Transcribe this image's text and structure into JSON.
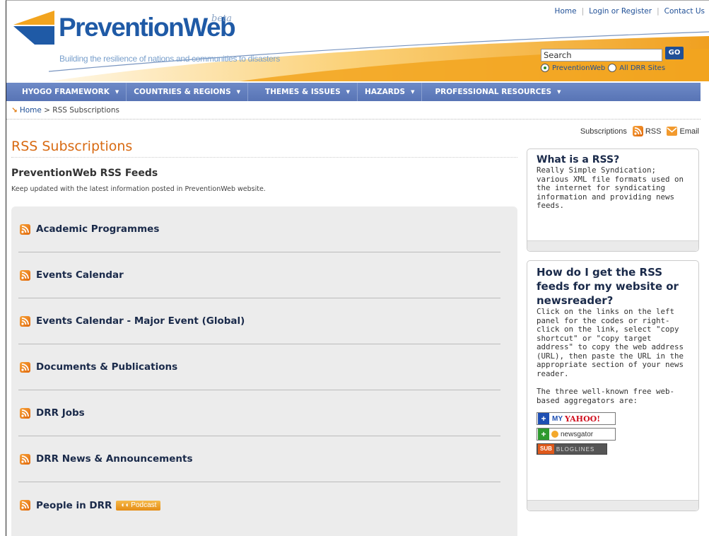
{
  "header": {
    "logo_text": "PreventionWeb",
    "logo_beta": "beta",
    "tagline": "Building the resilience of nations and communities to disasters",
    "top_links": [
      "Home",
      "Login or Register",
      "Contact Us"
    ],
    "search_value": "Search",
    "go_label": "GO",
    "scope_options": [
      "PreventionWeb",
      "All DRR Sites"
    ],
    "scope_selected": "PreventionWeb"
  },
  "nav": {
    "items": [
      "HYOGO FRAMEWORK",
      "COUNTRIES & REGIONS",
      "THEMES & ISSUES",
      "HAZARDS",
      "PROFESSIONAL RESOURCES"
    ]
  },
  "breadcrumb": {
    "home": "Home",
    "current": "> RSS Subscriptions"
  },
  "subscriptions": {
    "label": "Subscriptions",
    "rss": "RSS",
    "email": "Email"
  },
  "main": {
    "page_title": "RSS Subscriptions",
    "heading": "PreventionWeb RSS Feeds",
    "subheading": "Keep updated with the latest information posted in PreventionWeb website.",
    "feeds": [
      "Academic Programmes",
      "Events Calendar",
      "Events Calendar - Major Event (Global)",
      "Documents & Publications",
      "DRR Jobs",
      "DRR News & Announcements",
      "People in DRR"
    ],
    "podcast_label": "Podcast"
  },
  "sidebar": {
    "box1": {
      "title": "What is a RSS?",
      "text": "Really Simple Syndication; various XML file formats used on the internet for syndicating information and providing news feeds."
    },
    "box2": {
      "title": "How do I get the RSS feeds for my website or newsreader?",
      "text": "Click on the links on the left panel for the codes or right-click on the link, select \"copy shortcut\" or \"copy target address\" to copy the web address (URL), then paste the URL in the appropriate section of your news reader.",
      "text2": "The three well-known free web-based aggregators are:",
      "yahoo_my": "MY",
      "yahoo_brand": "YAHOO!",
      "newsgator": "newsgator",
      "bloglines_sub": "SUB",
      "bloglines": "BLOGLINES"
    }
  },
  "colors": {
    "accent_orange": "#d86a12",
    "nav_blue": "#5874b5",
    "link_blue": "#1f4f96"
  }
}
